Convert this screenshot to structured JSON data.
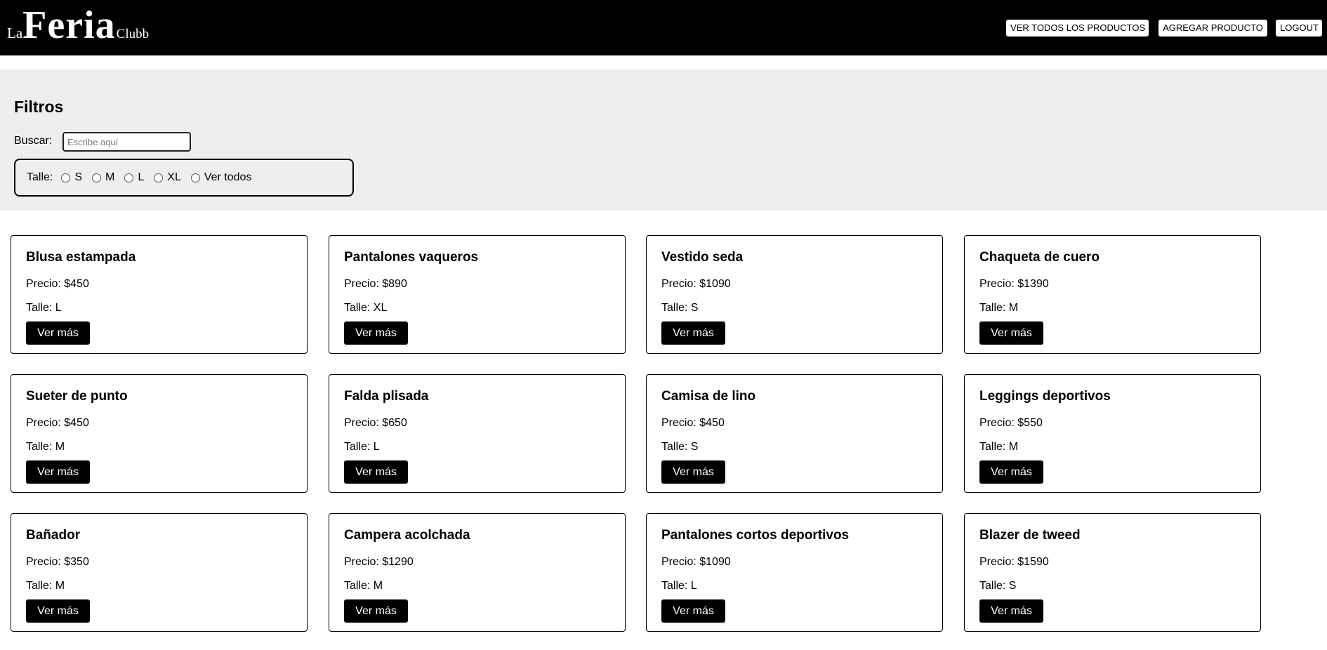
{
  "brand": {
    "prefix": "La",
    "name": "Feria",
    "suffix": "Clubb"
  },
  "nav": {
    "all_products": "VER TODOS LOS PRODUCTOS",
    "add_product": "AGREGAR PRODUCTO",
    "logout": "LOGOUT"
  },
  "filters": {
    "title": "Filtros",
    "search_label": "Buscar:",
    "search_placeholder": "Escribe aquí",
    "size_label": "Talle:",
    "size_options": [
      "S",
      "M",
      "L",
      "XL",
      "Ver todos"
    ]
  },
  "products": [
    {
      "name": "Blusa estampada",
      "price": "Precio: $450",
      "size": "Talle: L",
      "button": "Ver más"
    },
    {
      "name": "Pantalones vaqueros",
      "price": "Precio: $890",
      "size": "Talle: XL",
      "button": "Ver más"
    },
    {
      "name": "Vestido seda",
      "price": "Precio: $1090",
      "size": "Talle: S",
      "button": "Ver más"
    },
    {
      "name": "Chaqueta de cuero",
      "price": "Precio: $1390",
      "size": "Talle: M",
      "button": "Ver más"
    },
    {
      "name": "Sueter de punto",
      "price": "Precio: $450",
      "size": "Talle: M",
      "button": "Ver más"
    },
    {
      "name": "Falda plisada",
      "price": "Precio: $650",
      "size": "Talle: L",
      "button": "Ver más"
    },
    {
      "name": "Camisa de lino",
      "price": "Precio: $450",
      "size": "Talle: S",
      "button": "Ver más"
    },
    {
      "name": "Leggings deportivos",
      "price": "Precio: $550",
      "size": "Talle: M",
      "button": "Ver más"
    },
    {
      "name": "Bañador",
      "price": "Precio: $350",
      "size": "Talle: M",
      "button": "Ver más"
    },
    {
      "name": "Campera acolchada",
      "price": "Precio: $1290",
      "size": "Talle: M",
      "button": "Ver más"
    },
    {
      "name": "Pantalones cortos deportivos",
      "price": "Precio: $1090",
      "size": "Talle: L",
      "button": "Ver más"
    },
    {
      "name": "Blazer de tweed",
      "price": "Precio: $1590",
      "size": "Talle: S",
      "button": "Ver más"
    }
  ],
  "colors": {
    "header_bg": "#000000",
    "filters_bg": "#eeeeee",
    "button_bg": "#000000",
    "button_text": "#ffffff"
  }
}
